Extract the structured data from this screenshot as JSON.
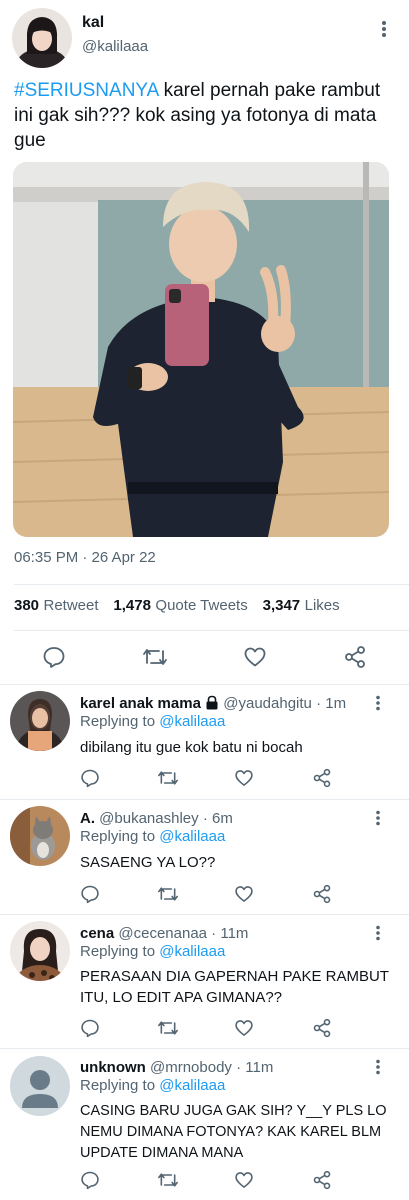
{
  "main_tweet": {
    "author_name": "kal",
    "author_handle": "@kalilaaa",
    "hashtag": "#SERIUSNANYA",
    "text_after_hashtag": " karel pernah pake rambut ini gak sih??? kok asing ya fotonya di mata gue",
    "time": "06:35 PM · 26 Apr 22",
    "retweets_count": "380",
    "retweets_label": "Retweet",
    "quotes_count": "1,478",
    "quotes_label": "Quote Tweets",
    "likes_count": "3,347",
    "likes_label": "Likes"
  },
  "replies": [
    {
      "name": "karel anak mama",
      "handle": "@yaudahgitu",
      "time": "1m",
      "locked": true,
      "replying_prefix": "Replying to",
      "replying_to": "@kalilaaa",
      "text": "dibilang itu gue kok batu ni bocah"
    },
    {
      "name": "A.",
      "handle": "@bukanashley",
      "time": "6m",
      "locked": false,
      "replying_prefix": "Replying to",
      "replying_to": "@kalilaaa",
      "text": "SASAENG YA LO??"
    },
    {
      "name": "cena",
      "handle": "@cecenanaa",
      "time": "11m",
      "locked": false,
      "replying_prefix": "Replying to",
      "replying_to": "@kalilaaa",
      "text": "PERASAAN DIA GAPERNAH PAKE RAMBUT ITU, LO EDIT APA GIMANA??"
    },
    {
      "name": "unknown",
      "handle": "@mrnobody",
      "time": "11m",
      "locked": false,
      "replying_prefix": "Replying to",
      "replying_to": "@kalilaaa",
      "text": "CASING BARU JUGA GAK SIH? Y__Y PLS LO NEMU DIMANA FOTONYA? KAK KAREL BLM UPDATE DIMANA MANA"
    }
  ],
  "colors": {
    "accent": "#1d9bf0",
    "muted": "#536471",
    "divider": "#e6ecf0"
  },
  "icons": [
    "more-vertical-icon",
    "reply-icon",
    "retweet-icon",
    "like-icon",
    "share-icon",
    "lock-icon"
  ]
}
